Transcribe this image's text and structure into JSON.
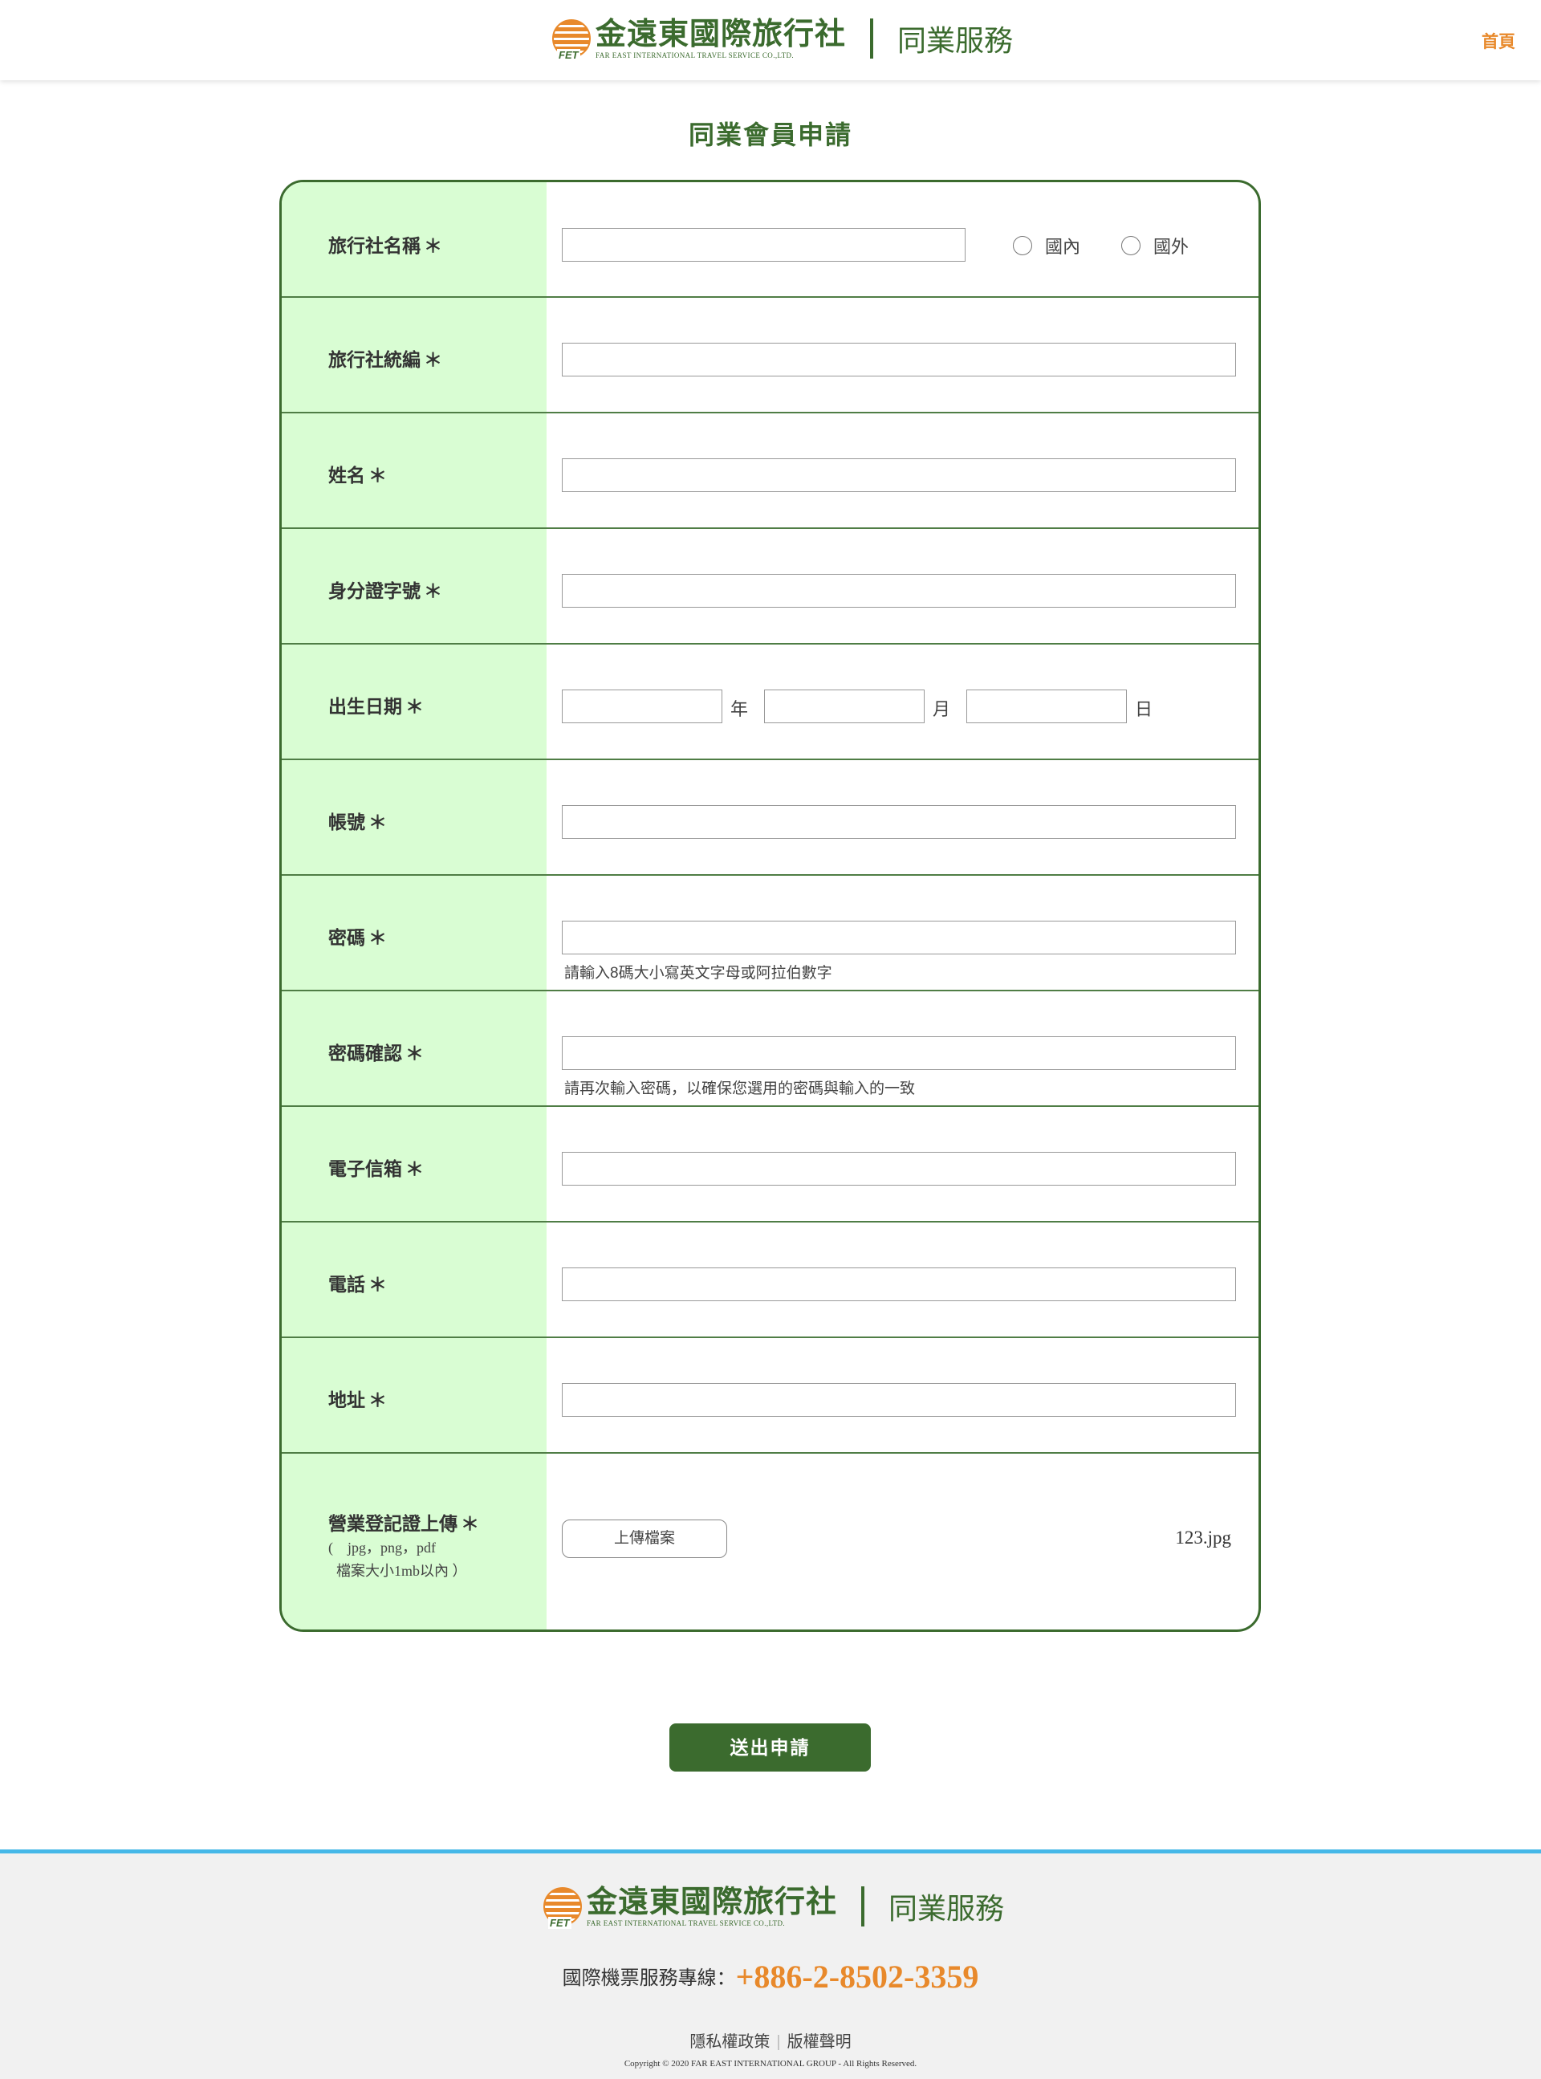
{
  "header": {
    "logo_cn": "金遠東國際旅行社",
    "logo_en": "FAR EAST INTERNATIONAL TRAVEL SERVICE CO.,LTD.",
    "logo_badge": "FET",
    "service": "同業服務",
    "home": "首頁"
  },
  "page_title": "同業會員申請",
  "form": {
    "required_mark": "＊",
    "agency_name": "旅行社名稱",
    "radio_domestic": "國內",
    "radio_foreign": "國外",
    "tax_id": "旅行社統編",
    "name": "姓名",
    "id_number": "身分證字號",
    "birthdate": "出生日期",
    "year": "年",
    "month": "月",
    "day": "日",
    "account": "帳號",
    "password": "密碼",
    "password_hint": "請輸入8碼大小寫英文字母或阿拉伯數字",
    "password_confirm": "密碼確認",
    "password_confirm_hint": "請再次輸入密碼，以確保您選用的密碼與輸入的一致",
    "email": "電子信箱",
    "phone": "電話",
    "address": "地址",
    "upload_label": "營業登記證上傳",
    "upload_types": "(　jpg，png，pdf",
    "upload_size": "檔案大小1mb以內 ）",
    "upload_button": "上傳檔案",
    "upload_file": "123.jpg"
  },
  "submit": "送出申請",
  "footer": {
    "hotline_label": "國際機票服務專線：",
    "hotline_number": "+886-2-8502-3359",
    "privacy": "隱私權政策",
    "copyright_statement": "版權聲明",
    "copyright": "Copyright © 2020 FAR EAST INTERNATIONAL GROUP - All Rights Reserved."
  },
  "colors": {
    "brand_green": "#3b6b2e",
    "label_bg": "#d9fdd3",
    "accent_orange": "#e8892b",
    "footer_line": "#46b8e8"
  }
}
